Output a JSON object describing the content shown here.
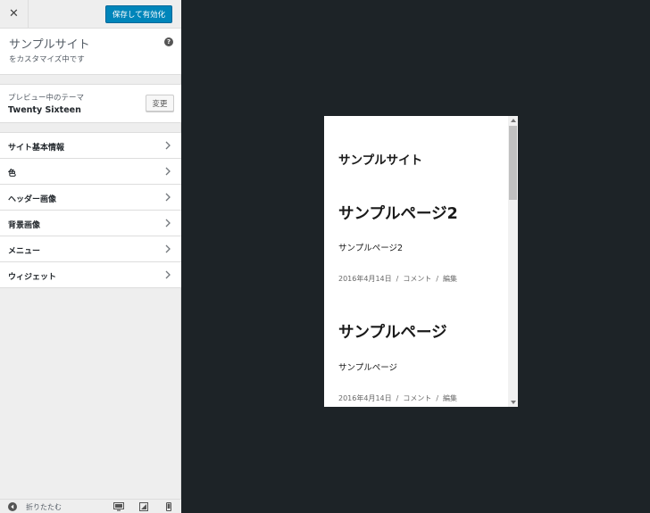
{
  "header": {
    "close_icon": "close-icon",
    "close_glyph": "✕",
    "save_label": "保存して有効化"
  },
  "info": {
    "site_title": "サンプルサイト",
    "customizing_text": "をカスタマイズ中です",
    "help_glyph": "?"
  },
  "theme": {
    "caption": "プレビュー中のテーマ",
    "name": "Twenty Sixteen",
    "change_label": "変更"
  },
  "menu": {
    "items": [
      {
        "label": "サイト基本情報"
      },
      {
        "label": "色"
      },
      {
        "label": "ヘッダー画像"
      },
      {
        "label": "背景画像"
      },
      {
        "label": "メニュー"
      },
      {
        "label": "ウィジェット"
      }
    ]
  },
  "footer": {
    "collapse_label": "折りたたむ",
    "devices": [
      "desktop-icon",
      "tablet-icon",
      "mobile-icon"
    ]
  },
  "preview": {
    "site_title": "サンプルサイト",
    "posts": [
      {
        "title": "サンプルページ2",
        "excerpt": "サンプルページ2",
        "date": "2016年4月14日",
        "comment": "コメント",
        "edit": "編集"
      },
      {
        "title": "サンプルページ",
        "excerpt": "サンプルページ",
        "date": "2016年4月14日",
        "comment": "コメント",
        "edit": "編集"
      }
    ]
  },
  "colors": {
    "accent": "#0085ba",
    "panel_bg": "#eeeeee",
    "preview_bg": "#1d2327"
  }
}
